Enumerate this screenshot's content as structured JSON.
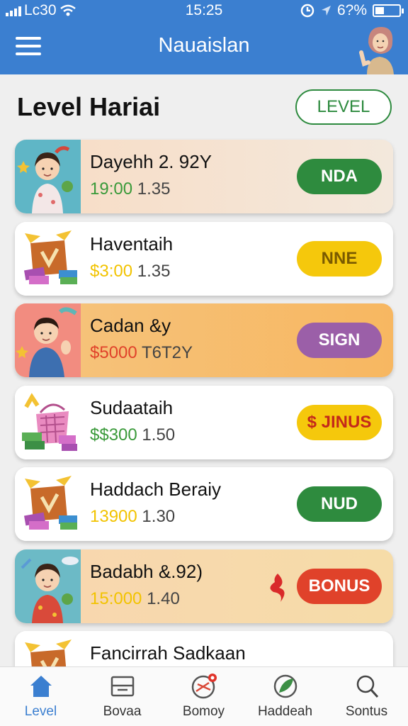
{
  "status": {
    "carrier": "Lc30",
    "time": "15:25",
    "battery": "6?%"
  },
  "header": {
    "title": "Nauaislan"
  },
  "page": {
    "title": "Level Hariai",
    "level_button": "LEVEL"
  },
  "items": [
    {
      "name": "Dayehh 2. 92Y",
      "amount_a": "19:00",
      "amount_b": "1.35",
      "amount_a_color": "#3a9a3a",
      "button": "NDA",
      "button_color": "#2e8b3e",
      "button_text_color": "#ffffff",
      "bg": "linear-gradient(90deg,#f8dcc4,#f3e8dc)",
      "thumb": "girl"
    },
    {
      "name": "Haventaih",
      "amount_a": "$3:00",
      "amount_b": "1.35",
      "amount_a_color": "#f2c300",
      "button": "NNE",
      "button_color": "#f5c80c",
      "button_text_color": "#7a5a00",
      "bg": "#ffffff",
      "thumb": "box"
    },
    {
      "name": "Cadan &y",
      "amount_a": "$5000",
      "amount_b": "T6T2Y",
      "amount_a_color": "#e0422a",
      "button": "SIGN",
      "button_color": "#9b5fa8",
      "button_text_color": "#ffffff",
      "bg": "linear-gradient(90deg,#f6c47e,#f7b761)",
      "thumb": "boy"
    },
    {
      "name": "Sudaataih",
      "amount_a": "$$300",
      "amount_b": "1.50",
      "amount_a_color": "#3a9a3a",
      "button": "$ JINUS",
      "button_color": "#f5c80c",
      "button_text_color": "#c42a1a",
      "bg": "#ffffff",
      "thumb": "basket"
    },
    {
      "name": "Haddach Beraiy",
      "amount_a": "13900",
      "amount_b": "1.30",
      "amount_a_color": "#f2c300",
      "button": "NUD",
      "button_color": "#2e8b3e",
      "button_text_color": "#ffffff",
      "bg": "#ffffff",
      "thumb": "box"
    },
    {
      "name": "Badabh &.92)",
      "amount_a": "15:000",
      "amount_b": "1.40",
      "amount_a_color": "#f2c300",
      "button": "BONUS",
      "button_color": "#e0422a",
      "button_text_color": "#ffffff",
      "bg": "linear-gradient(90deg,#f8d6b0,#f6dca8)",
      "thumb": "girl2",
      "spark": true
    },
    {
      "name": "Fancirrah Sadkaan",
      "amount_a": "",
      "amount_b": "",
      "amount_a_color": "#3a9a3a",
      "button": "",
      "button_color": "#2e8b3e",
      "button_text_color": "#ffffff",
      "bg": "#ffffff",
      "thumb": "box"
    }
  ],
  "tabs": [
    {
      "label": "Level",
      "icon": "home-icon",
      "active": true
    },
    {
      "label": "Bovaa",
      "icon": "inbox-icon",
      "active": false
    },
    {
      "label": "Bomoy",
      "icon": "bonus-icon",
      "active": false
    },
    {
      "label": "Haddeah",
      "icon": "leaf-icon",
      "active": false
    },
    {
      "label": "Sontus",
      "icon": "search-icon",
      "active": false
    }
  ]
}
